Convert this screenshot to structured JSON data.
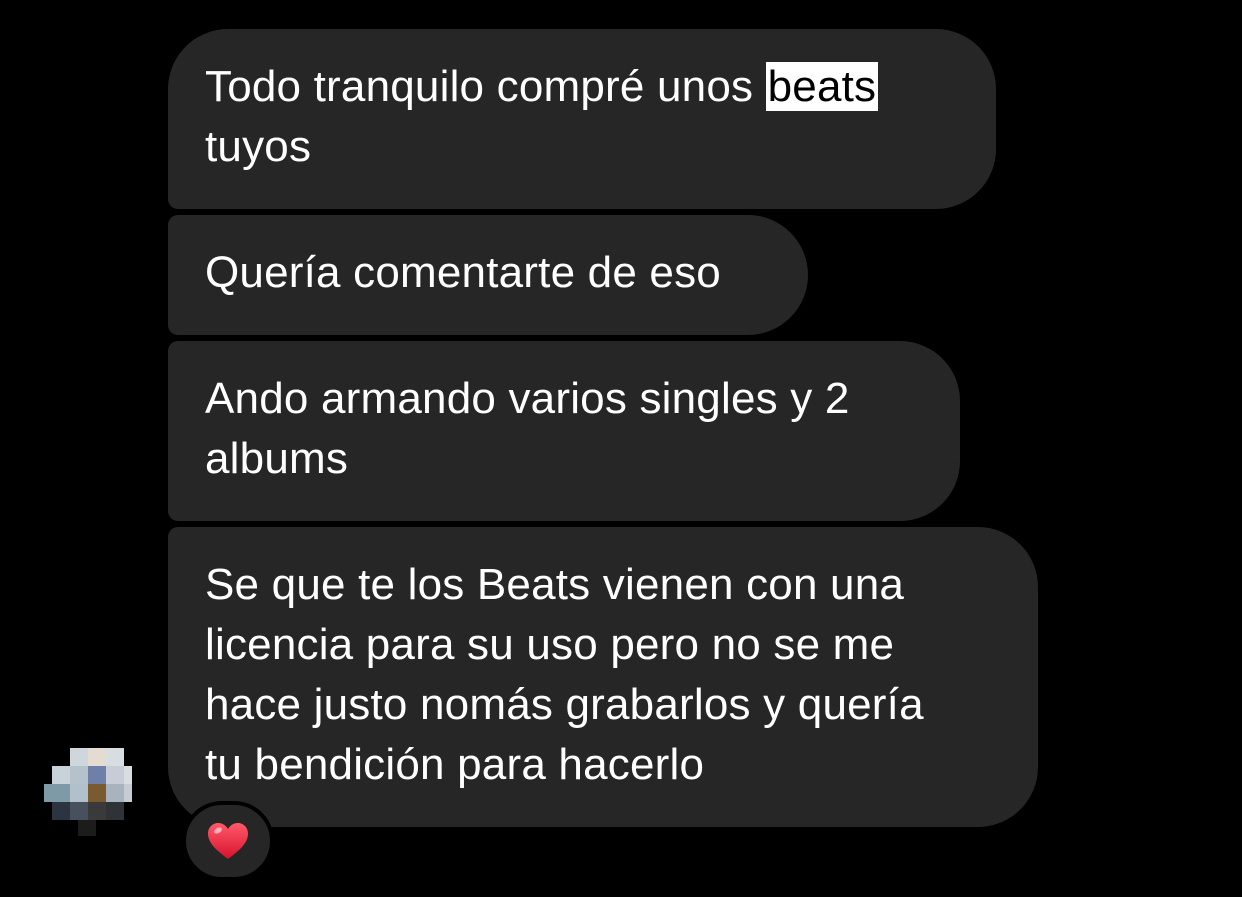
{
  "messages": [
    {
      "lines": [
        "Todo tranquilo compré unos ",
        "tuyos"
      ],
      "highlight": "beats"
    },
    {
      "lines": [
        "Quería comentarte de eso"
      ]
    },
    {
      "lines": [
        "Ando armando varios singles y 2",
        "albums"
      ]
    },
    {
      "lines": [
        "Se que te los Beats vienen con una",
        "licencia para su uso pero no se me",
        "hace justo nomás grabarlos y quería",
        "tu bendición para hacerlo"
      ]
    }
  ],
  "reaction": {
    "emoji_icon": "red-heart-icon",
    "color": "#e0243a"
  },
  "colors": {
    "background": "#000000",
    "bubble": "#262626",
    "text": "#ffffff"
  }
}
